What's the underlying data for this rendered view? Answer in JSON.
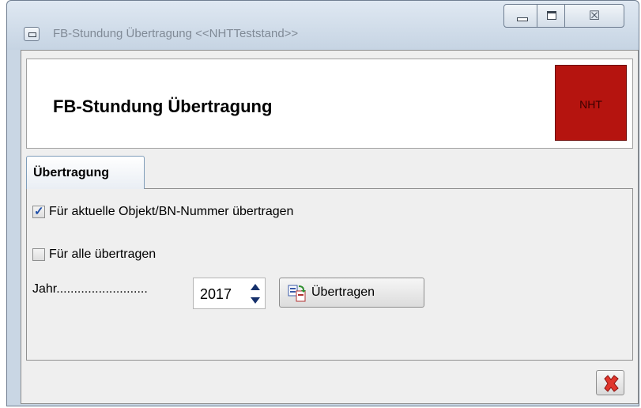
{
  "window": {
    "title": "FB-Stundung Übertragung  <<NHTTeststand>>",
    "controls": {
      "minimize_icon": "minimize-icon",
      "maximize_icon": "maximize-icon",
      "close_glyph": "☒"
    }
  },
  "header": {
    "title": "FB-Stundung Übertragung",
    "badge": "NHT",
    "badge_color": "#b5140f"
  },
  "tabs": [
    {
      "label": "Übertragung",
      "active": true
    }
  ],
  "options": {
    "current_object": {
      "label": "Für aktuelle Objekt/BN-Nummer übertragen",
      "checked": true
    },
    "all": {
      "label": "Für alle übertragen",
      "checked": false
    }
  },
  "year": {
    "label": "Jahr..........................",
    "value": "2017"
  },
  "actions": {
    "transfer_label": "Übertragen",
    "transfer_icon": "transfer-icon",
    "close_icon": "close-red-x-icon"
  }
}
